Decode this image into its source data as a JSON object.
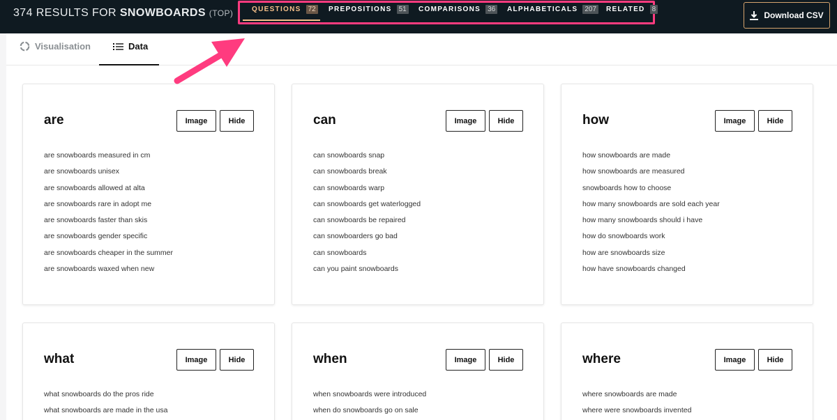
{
  "header": {
    "results_prefix": "374 RESULTS FOR",
    "term": "SNOWBOARDS",
    "mode": "(TOP)",
    "tabs": [
      {
        "label": "QUESTIONS",
        "count": "72"
      },
      {
        "label": "PREPOSITIONS",
        "count": "51"
      },
      {
        "label": "COMPARISONS",
        "count": "36"
      },
      {
        "label": "ALPHABETICALS",
        "count": "207"
      },
      {
        "label": "RELATED",
        "count": "8"
      }
    ],
    "download_label": "Download CSV",
    "download_icon": "download-icon"
  },
  "view_tabs": {
    "visualisation": "Visualisation",
    "data": "Data"
  },
  "card_buttons": {
    "image": "Image",
    "hide": "Hide"
  },
  "cards": [
    {
      "title": "are",
      "items": [
        "are snowboards measured in cm",
        "are snowboards unisex",
        "are snowboards allowed at alta",
        "are snowboards rare in adopt me",
        "are snowboards faster than skis",
        "are snowboards gender specific",
        "are snowboards cheaper in the summer",
        "are snowboards waxed when new"
      ]
    },
    {
      "title": "can",
      "items": [
        "can snowboards snap",
        "can snowboards break",
        "can snowboards warp",
        "can snowboards get waterlogged",
        "can snowboards be repaired",
        "can snowboarders go bad",
        "can snowboards",
        "can you paint snowboards"
      ]
    },
    {
      "title": "how",
      "items": [
        "how snowboards are made",
        "how snowboards are measured",
        "snowboards how to choose",
        "how many snowboards are sold each year",
        "how many snowboards should i have",
        "how do snowboards work",
        "how are snowboards size",
        "how have snowboards changed"
      ]
    },
    {
      "title": "what",
      "items": [
        "what snowboards do the pros ride",
        "what snowboards are made in the usa"
      ]
    },
    {
      "title": "when",
      "items": [
        "when snowboards were introduced",
        "when do snowboards go on sale"
      ]
    },
    {
      "title": "where",
      "items": [
        "where snowboards are made",
        "where were snowboards invented"
      ]
    }
  ],
  "colors": {
    "topbar": "#0f1a21",
    "accent": "#f7c18a",
    "highlight_box": "#ff3b7f",
    "arrow": "#ff3b7f"
  }
}
